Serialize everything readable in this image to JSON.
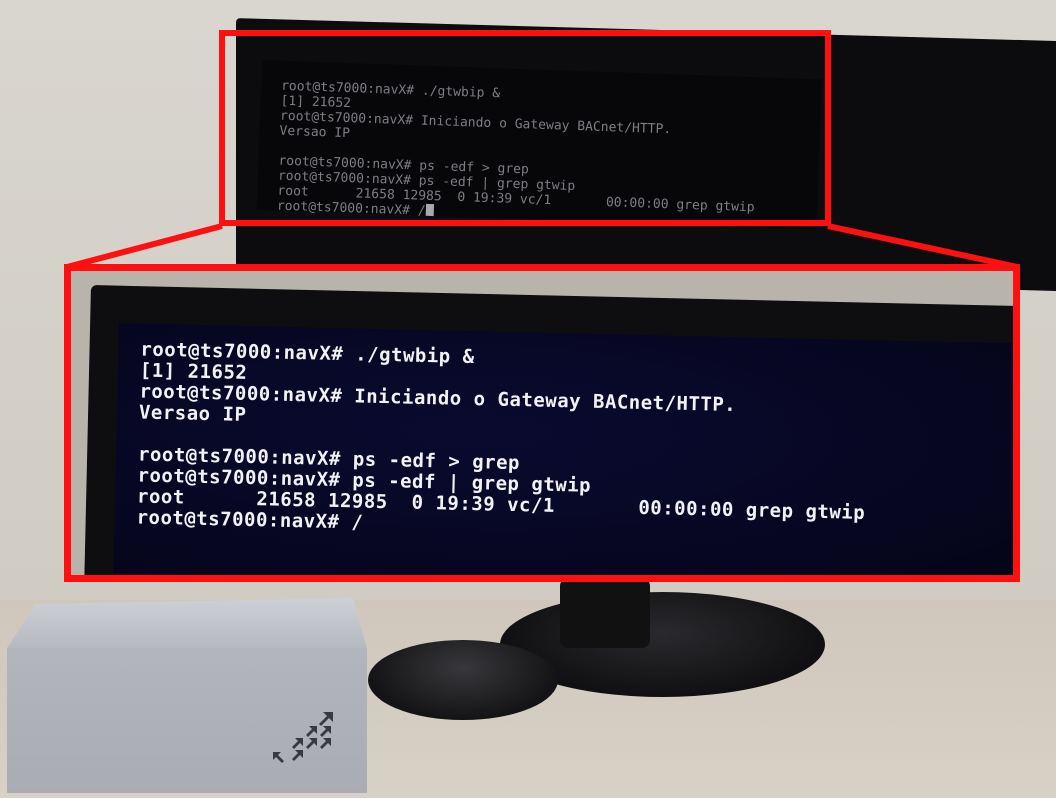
{
  "top_screen": {
    "lines": [
      "root@ts7000:navX# ./gtwbip &",
      "[1] 21652",
      "root@ts7000:navX# Iniciando o Gateway BACnet/HTTP.",
      "Versao IP",
      "",
      "root@ts7000:navX# ps -edf > grep",
      "root@ts7000:navX# ps -edf | grep gtwip",
      "root      21658 12985  0 19:39 vc/1       00:00:00 grep gtwip",
      "root@ts7000:navX# /"
    ]
  },
  "zoomed_screen": {
    "lines": [
      "root@ts7000:navX# ./gtwbip &",
      "[1] 21652",
      "root@ts7000:navX# Iniciando o Gateway BACnet/HTTP.",
      "Versao IP",
      "",
      "root@ts7000:navX# ps -edf > grep",
      "root@ts7000:navX# ps -edf | grep gtwip",
      "root      21658 12985  0 19:39 vc/1       00:00:00 grep gtwip",
      "root@ts7000:navX# /"
    ]
  },
  "colors": {
    "highlight": "#ff1010",
    "terminal_bg": "#060620",
    "terminal_fg": "#f2f2f6"
  },
  "icons": {
    "device_logo": "arrow-grid-icon"
  }
}
